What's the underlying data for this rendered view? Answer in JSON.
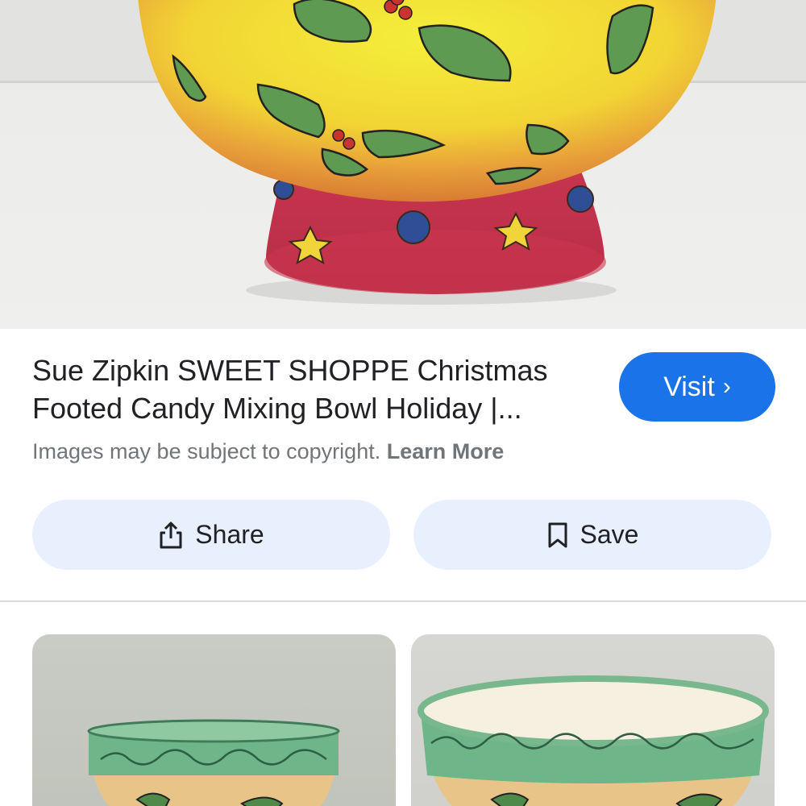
{
  "result": {
    "title": "Sue Zipkin SWEET SHOPPE Christmas Footed Candy Mixing Bowl Holiday |...",
    "visit_label": "Visit",
    "visit_chevron": "›",
    "copyright_text": "Images may be subject to copyright.",
    "learn_more_label": "Learn More"
  },
  "actions": {
    "share_label": "Share",
    "save_label": "Save"
  },
  "icons": {
    "share": "share-icon",
    "save": "bookmark-icon",
    "visit": "chevron-right-icon"
  },
  "colors": {
    "accent": "#1a73e8",
    "action_bg": "#e8f0fe",
    "title_text": "#202124",
    "muted_text": "#70757a"
  }
}
